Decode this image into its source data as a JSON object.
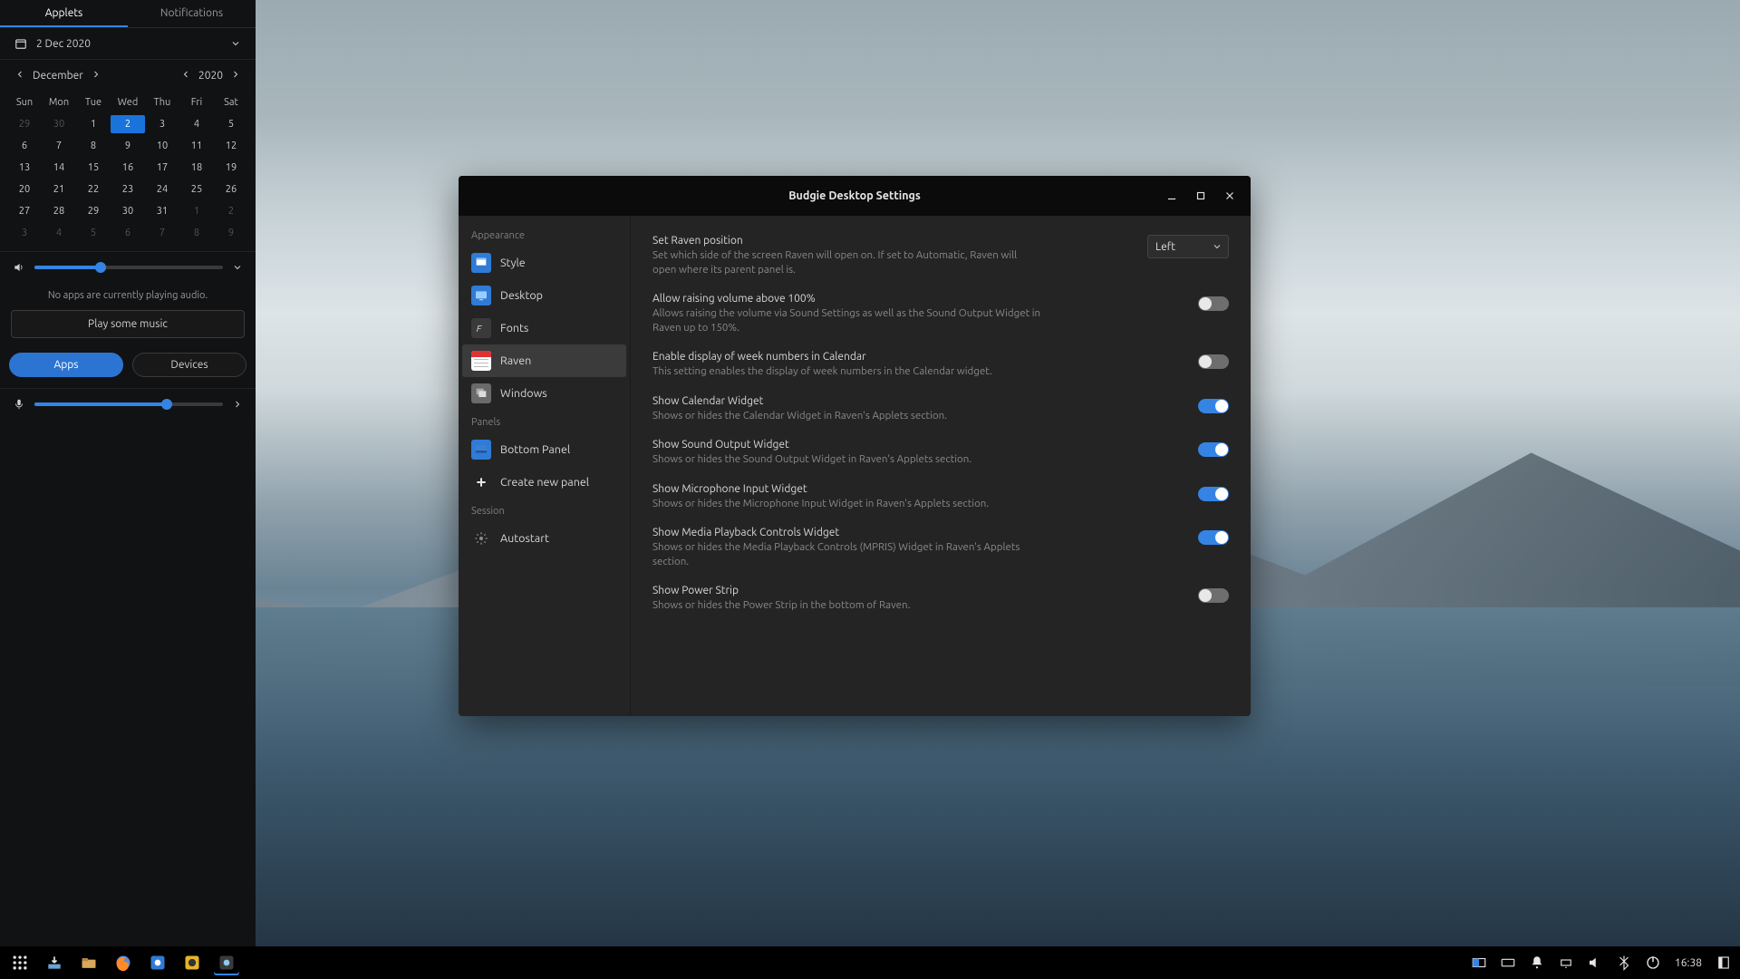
{
  "raven": {
    "tabs": {
      "applets": "Applets",
      "notifications": "Notifications"
    },
    "date_display": "2 Dec 2020",
    "month_label": "December",
    "year_label": "2020",
    "weekdays": [
      "Sun",
      "Mon",
      "Tue",
      "Wed",
      "Thu",
      "Fri",
      "Sat"
    ],
    "days": [
      {
        "n": "29",
        "out": true
      },
      {
        "n": "30",
        "out": true
      },
      {
        "n": "1"
      },
      {
        "n": "2",
        "today": true
      },
      {
        "n": "3"
      },
      {
        "n": "4"
      },
      {
        "n": "5"
      },
      {
        "n": "6"
      },
      {
        "n": "7"
      },
      {
        "n": "8"
      },
      {
        "n": "9"
      },
      {
        "n": "10"
      },
      {
        "n": "11"
      },
      {
        "n": "12"
      },
      {
        "n": "13"
      },
      {
        "n": "14"
      },
      {
        "n": "15"
      },
      {
        "n": "16"
      },
      {
        "n": "17"
      },
      {
        "n": "18"
      },
      {
        "n": "19"
      },
      {
        "n": "20"
      },
      {
        "n": "21"
      },
      {
        "n": "22"
      },
      {
        "n": "23"
      },
      {
        "n": "24"
      },
      {
        "n": "25"
      },
      {
        "n": "26"
      },
      {
        "n": "27"
      },
      {
        "n": "28"
      },
      {
        "n": "29"
      },
      {
        "n": "30"
      },
      {
        "n": "31"
      },
      {
        "n": "1",
        "out": true
      },
      {
        "n": "2",
        "out": true
      },
      {
        "n": "3",
        "out": true
      },
      {
        "n": "4",
        "out": true
      },
      {
        "n": "5",
        "out": true
      },
      {
        "n": "6",
        "out": true
      },
      {
        "n": "7",
        "out": true
      },
      {
        "n": "8",
        "out": true
      },
      {
        "n": "9",
        "out": true
      }
    ],
    "volume_percent": 35,
    "no_audio_text": "No apps are currently playing audio.",
    "play_music_label": "Play some music",
    "seg_apps": "Apps",
    "seg_devices": "Devices",
    "mic_percent": 70
  },
  "settings": {
    "window_title": "Budgie Desktop Settings",
    "sections": {
      "appearance": "Appearance",
      "panels": "Panels",
      "session": "Session"
    },
    "sidebar": {
      "style": "Style",
      "desktop": "Desktop",
      "fonts": "Fonts",
      "raven": "Raven",
      "windows": "Windows",
      "bottom_panel": "Bottom Panel",
      "create_panel": "Create new panel",
      "autostart": "Autostart"
    },
    "raven_position": {
      "title": "Set Raven position",
      "desc": "Set which side of the screen Raven will open on. If set to Automatic, Raven will open where its parent panel is.",
      "value": "Left"
    },
    "volume_above": {
      "title": "Allow raising volume above 100%",
      "desc": "Allows raising the volume via Sound Settings as well as the Sound Output Widget in Raven up to 150%.",
      "on": false
    },
    "week_numbers": {
      "title": "Enable display of week numbers in Calendar",
      "desc": "This setting enables the display of week numbers in the Calendar widget.",
      "on": false
    },
    "show_calendar": {
      "title": "Show Calendar Widget",
      "desc": "Shows or hides the Calendar Widget in Raven's Applets section.",
      "on": true
    },
    "show_sound": {
      "title": "Show Sound Output Widget",
      "desc": "Shows or hides the Sound Output Widget in Raven's Applets section.",
      "on": true
    },
    "show_mic": {
      "title": "Show Microphone Input Widget",
      "desc": "Shows or hides the Microphone Input Widget in Raven's Applets section.",
      "on": true
    },
    "show_mpris": {
      "title": "Show Media Playback Controls Widget",
      "desc": "Shows or hides the Media Playback Controls (MPRIS) Widget in Raven's Applets section.",
      "on": true
    },
    "show_power": {
      "title": "Show Power Strip",
      "desc": "Shows or hides the Power Strip in the bottom of Raven.",
      "on": false
    }
  },
  "taskbar": {
    "clock": "16:38",
    "tray_icons": [
      "workspace",
      "keyboard",
      "notification",
      "network",
      "volume",
      "bluetooth",
      "power"
    ],
    "launchers": [
      "apps",
      "downloads",
      "files",
      "firefox",
      "software",
      "rhythmbox",
      "settings"
    ]
  },
  "colors": {
    "accent": "#3584e4"
  }
}
